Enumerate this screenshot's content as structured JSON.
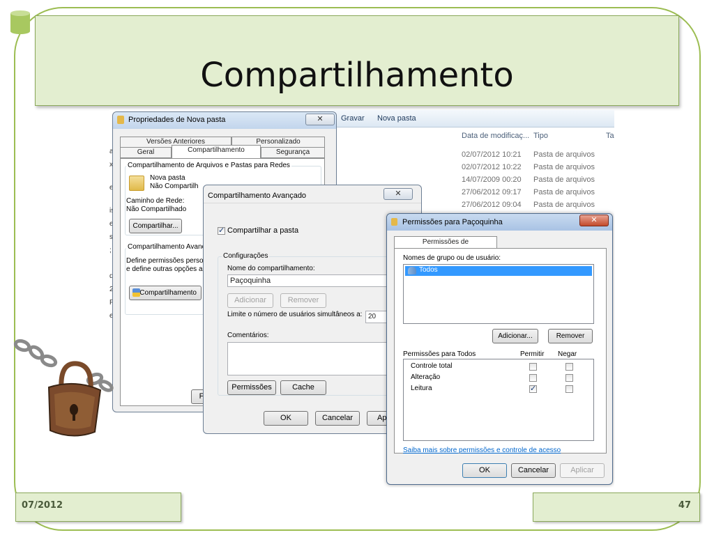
{
  "slide": {
    "title": "Compartilhamento",
    "footer_date": "07/2012",
    "page_number": "47"
  },
  "colors": {
    "frame_border": "#9cbd52",
    "title_box_bg": "#e3eed0",
    "titlebar": "#c2d5ec",
    "link": "#0066cc"
  },
  "explorer": {
    "toolbar": [
      "Gravar",
      "Nova pasta"
    ],
    "columns": [
      "Data de modificaç...",
      "Tipo",
      "Tar"
    ],
    "rows": [
      {
        "date": "02/07/2012 10:21",
        "type": "Pasta de arquivos"
      },
      {
        "date": "02/07/2012 10:22",
        "type": "Pasta de arquivos"
      },
      {
        "date": "14/07/2009 00:20",
        "type": "Pasta de arquivos"
      },
      {
        "date": "27/06/2012 09:17",
        "type": "Pasta de arquivos"
      },
      {
        "date": "27/06/2012 09:04",
        "type": "Pasta de arquivos"
      }
    ],
    "left_glyphs": [
      "a",
      "x",
      "e",
      "is",
      "e",
      "s",
      ";",
      "d",
      "2",
      "P",
      "e"
    ]
  },
  "props_dialog": {
    "title": "Propriedades de Nova pasta",
    "tabs_row1": [
      "Versões Anteriores",
      "Personalizado"
    ],
    "tabs_row2": [
      "Geral",
      "Compartilhamento",
      "Segurança"
    ],
    "section1": "Compartilhamento de Arquivos e Pastas para Redes",
    "folder_name": "Nova pasta",
    "folder_status": "Não Compartilh",
    "path_label": "Caminho de Rede:",
    "path_value": "Não Compartilhado",
    "share_btn": "Compartilhar...",
    "section2": "Compartilhamento Avanç",
    "section2_desc1": "Define permissões perso",
    "section2_desc2": "e define outras opções a",
    "adv_btn": "Compartilhamento",
    "bottom_btn": "F"
  },
  "adv_dialog": {
    "title": "Compartilhamento Avançado",
    "share_checkbox": "Compartilhar a pasta",
    "share_checked": true,
    "config_label": "Configurações",
    "share_name_label": "Nome do compartilhamento:",
    "share_name_value": "Paçoquinha",
    "add_btn": "Adicionar",
    "remove_btn": "Remover",
    "limit_label": "Limite o número de usuários simultâneos a:",
    "limit_value": "20",
    "comments_label": "Comentários:",
    "perm_btn": "Permissões",
    "cache_btn": "Cache",
    "ok": "OK",
    "cancel": "Cancelar",
    "apply": "Apl"
  },
  "perm_dialog": {
    "title": "Permissões para Paçoquinha",
    "tab": "Permissões de compartilhamento",
    "groups_label": "Nomes de grupo ou de usuário:",
    "groups": [
      "Todos"
    ],
    "add_btn": "Adicionar...",
    "remove_btn": "Remover",
    "perms_label": "Permissões para Todos",
    "allow_col": "Permitir",
    "deny_col": "Negar",
    "perms": [
      {
        "name": "Controle total",
        "allow": false,
        "deny": false
      },
      {
        "name": "Alteração",
        "allow": false,
        "deny": false
      },
      {
        "name": "Leitura",
        "allow": true,
        "deny": false
      }
    ],
    "help_link": "Saiba mais sobre permissões e controle de acesso",
    "ok": "OK",
    "cancel": "Cancelar",
    "apply": "Aplicar"
  }
}
